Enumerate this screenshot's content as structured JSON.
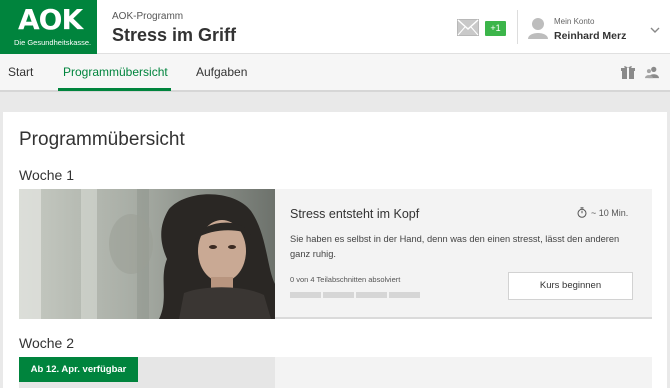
{
  "header": {
    "logo": {
      "mark": "AOK",
      "tagline": "Die Gesundheitskasse."
    },
    "program_sub": "AOK-Programm",
    "program_title": "Stress im Griff",
    "notifications_badge": "+1",
    "account": {
      "label": "Mein Konto",
      "name": "Reinhard Merz"
    }
  },
  "nav": {
    "tabs": [
      {
        "label": "Start",
        "active": false
      },
      {
        "label": "Programmübersicht",
        "active": true
      },
      {
        "label": "Aufgaben",
        "active": false
      }
    ]
  },
  "main": {
    "page_title": "Programmübersicht",
    "weeks": [
      {
        "label": "Woche 1",
        "lesson": {
          "title": "Stress entsteht im Kopf",
          "duration": "~ 10 Min.",
          "description": "Sie haben es selbst in der Hand, denn was den einen stresst, lässt den anderen ganz ruhig.",
          "progress_text": "0 von 4 Teilabschnitten absolviert",
          "progress_completed": 0,
          "progress_total": 4,
          "button_label": "Kurs beginnen"
        }
      },
      {
        "label": "Woche 2",
        "availability_badge": "Ab 12. Apr. verfügbar"
      }
    ]
  },
  "colors": {
    "brand_green": "#00843d",
    "badge_green": "#3cb54a"
  }
}
